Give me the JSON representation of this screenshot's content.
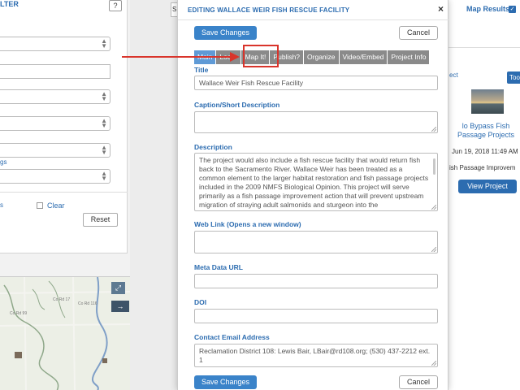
{
  "background": {
    "filter": {
      "title_fragment": "LTER",
      "help_label": "?",
      "link_fragment": "gs",
      "is_fragment": "s",
      "clear_label": "Clear",
      "reset_label": "Reset"
    },
    "map": {
      "road_label_1": "Co Rd 116",
      "road_label_2": "Co Rd 17",
      "road_label_3": "Co Rd 99",
      "expand_icon": "⤢",
      "arrow_icon": "→"
    },
    "results": {
      "map_results_label": "Map Results",
      "ect_link": "ect",
      "tool_label": "Too",
      "project_title": "lo Bypass Fish Passage Projects",
      "project_date": "Jun 19, 2018 11:49 AM",
      "project_category": "ish Passage Improvem",
      "view_project_label": "View Project"
    },
    "mid_fragment": "S"
  },
  "modal": {
    "title": "EDITING WALLACE WEIR FISH RESCUE FACILITY",
    "close_label": "×",
    "save_label": "Save Changes",
    "cancel_label": "Cancel",
    "tabs": [
      {
        "label": "Main"
      },
      {
        "label": "Loc"
      },
      {
        "label": "Map It!"
      },
      {
        "label": "Publish?"
      },
      {
        "label": "Organize"
      },
      {
        "label": "Video/Embed"
      },
      {
        "label": "Project Info"
      }
    ],
    "fields": {
      "title_label": "Title",
      "title_value": "Wallace Weir Fish Rescue Facility",
      "caption_label": "Caption/Short Description",
      "caption_value": "",
      "description_label": "Description",
      "description_value": "The project would also include a fish rescue facility that would return fish back to the Sacramento River. Wallace Weir has been treated as a common element to the larger habitat restoration and fish passage projects included in the 2009 NMFS Biological Opinion. This project will serve primarily as a fish passage improvement action that will prevent upstream migration of straying adult salmonids and sturgeon into the",
      "weblink_label": "Web Link (Opens a new window)",
      "weblink_value": "",
      "metadata_label": "Meta Data URL",
      "metadata_value": "",
      "doi_label": "DOI",
      "doi_value": "",
      "contact_label": "Contact Email Address",
      "contact_value": "Reclamation District 108: Lewis Bair, LBair@rd108.org; (530) 437-2212 ext. 1"
    }
  },
  "colors": {
    "accent": "#2c6cb0",
    "primary_button": "#3a83c9",
    "annotation": "#d9342b",
    "tab_inactive": "#8a8a8a",
    "tab_active": "#5f9ad6"
  }
}
